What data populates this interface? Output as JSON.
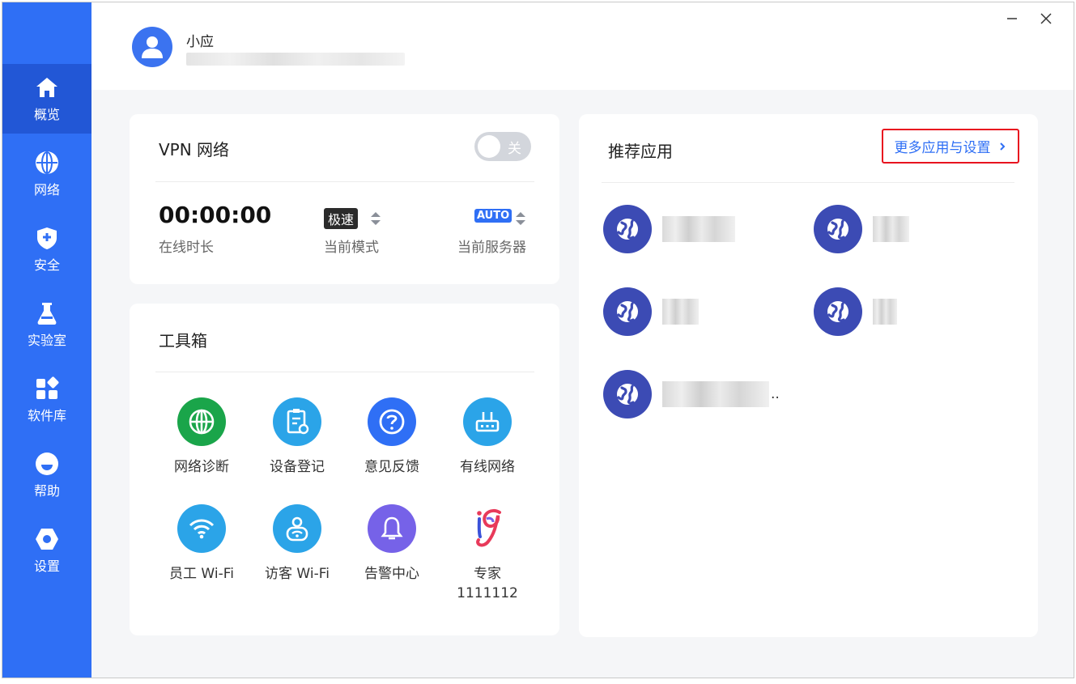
{
  "sidebar": {
    "items": [
      {
        "label": "概览",
        "icon": "home-icon",
        "active": true
      },
      {
        "label": "网络",
        "icon": "globe-icon"
      },
      {
        "label": "安全",
        "icon": "shield-plus-icon"
      },
      {
        "label": "实验室",
        "icon": "flask-icon"
      },
      {
        "label": "软件库",
        "icon": "apps-grid-icon"
      },
      {
        "label": "帮助",
        "icon": "help-icon"
      },
      {
        "label": "设置",
        "icon": "hex-settings-icon"
      }
    ]
  },
  "header": {
    "username": "小应"
  },
  "vpn": {
    "title": "VPN 网络",
    "toggle_label": "关",
    "toggle_on": false,
    "duration_value": "00:00:00",
    "duration_label": "在线时长",
    "mode_value": "极速",
    "mode_label": "当前模式",
    "server_value": "AUTO",
    "server_label": "当前服务器"
  },
  "toolbox": {
    "title": "工具箱",
    "tools": [
      {
        "label": "网络诊断",
        "icon": "network-diagnose-icon",
        "color": "#1aa54a"
      },
      {
        "label": "设备登记",
        "icon": "device-register-icon",
        "color": "#2ba4e8"
      },
      {
        "label": "意见反馈",
        "icon": "question-feedback-icon",
        "color": "#2f6ff5"
      },
      {
        "label": "有线网络",
        "icon": "router-icon",
        "color": "#2ba4e8"
      },
      {
        "label": "员工 Wi-Fi",
        "icon": "wifi-icon",
        "color": "#2ba4e8"
      },
      {
        "label": "访客 Wi-Fi",
        "icon": "guest-wifi-icon",
        "color": "#2ba4e8"
      },
      {
        "label": "告警中心",
        "icon": "bell-icon",
        "color": "#7662e8"
      },
      {
        "label": "专家\n1111112",
        "icon": "expert-logo-icon",
        "color": "#e83a5a"
      }
    ]
  },
  "recommended": {
    "title": "推荐应用",
    "more_label": "更多应用与设置",
    "apps": [
      {
        "icon": "app-globe-icon"
      },
      {
        "icon": "app-globe-icon"
      },
      {
        "icon": "app-globe-icon"
      },
      {
        "icon": "app-globe-icon"
      },
      {
        "icon": "app-globe-icon",
        "suffix": ".."
      }
    ]
  },
  "colors": {
    "sidebar": "#2f6ff5",
    "sidebar_active": "#2257d6",
    "accent": "#2f6ff5",
    "app_icon": "#3c4bb4",
    "highlight_border": "#e8131f"
  }
}
